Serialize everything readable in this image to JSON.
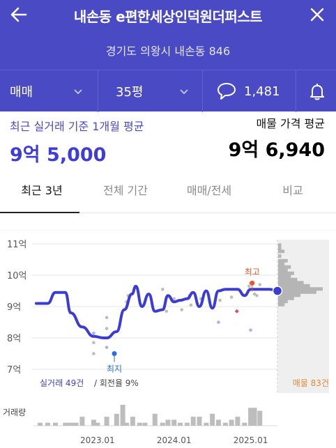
{
  "header": {
    "title": "내손동 e편한세상인덕원더퍼스트",
    "address": "경기도 의왕시 내손동 846",
    "trade_type": "매매",
    "area": "35평",
    "comment_count": "1,481",
    "back_icon": "arrow-left-icon",
    "close_icon": "close-icon",
    "comment_icon": "speech-bubble-icon",
    "bell_icon": "bell-icon"
  },
  "summary": {
    "left_caption": "최근 실거래 기준 1개월 평균",
    "left_value": "9억 5,000",
    "right_caption": "매물 가격 평균",
    "right_value": "9억 6,940"
  },
  "tabs": [
    {
      "label": "최근 3년",
      "active": true
    },
    {
      "label": "전체 기간",
      "active": false
    },
    {
      "label": "매매/전세",
      "active": false
    },
    {
      "label": "비교",
      "active": false
    }
  ],
  "colors": {
    "header_bg": "#4a4ac4",
    "line": "#3b3bd6",
    "high_marker": "#e8582c",
    "low_marker": "#2a6fe0",
    "listing_text": "#e08a3a",
    "dots": "#bdbdbd",
    "dots_blue": "#9fb6ea"
  },
  "chart_data": {
    "type": "line",
    "y_unit": "억",
    "ylim": [
      7,
      11
    ],
    "y_ticks": [
      "11억",
      "10억",
      "9억",
      "8억",
      "7억"
    ],
    "y_tick_values": [
      11,
      10,
      9,
      8,
      7
    ],
    "x_ticks": [
      "2023.01",
      "2024.01",
      "2025.01"
    ],
    "x_tick_months": [
      2023.0,
      2024.0,
      2025.0
    ],
    "x_range": [
      2022.2,
      2025.35
    ],
    "grid": true,
    "series": [
      {
        "values_x": [
          2022.2,
          2022.35,
          2022.45,
          2022.58,
          2022.65,
          2022.8,
          2022.95,
          2023.08,
          2023.12,
          2023.25,
          2023.35,
          2023.45,
          2023.5,
          2023.58,
          2023.67,
          2023.75,
          2023.85,
          2023.92,
          2024.0,
          2024.08,
          2024.17,
          2024.25,
          2024.33,
          2024.42,
          2024.5,
          2024.58,
          2024.67,
          2024.75,
          2024.83,
          2024.92,
          2025.0,
          2025.08,
          2025.17,
          2025.25,
          2025.35
        ],
        "values_y": [
          9.1,
          9.1,
          9.45,
          9.45,
          8.8,
          8.35,
          8.05,
          8.0,
          8.0,
          8.2,
          8.9,
          9.4,
          9.65,
          9.0,
          9.4,
          8.85,
          8.9,
          9.35,
          9.15,
          9.2,
          9.25,
          9.45,
          9.0,
          9.5,
          8.95,
          9.5,
          9.55,
          9.55,
          9.55,
          9.35,
          9.55,
          9.55,
          9.55,
          9.55,
          9.5
        ]
      }
    ],
    "scatter_x": [
      2022.95,
      2022.95,
      2023.12,
      2023.12,
      2023.35,
      2023.38,
      2023.4,
      2023.85,
      2023.9,
      2024.0,
      2024.1,
      2024.2,
      2024.22,
      2024.35,
      2024.6,
      2024.75,
      2024.98,
      2025.0,
      2025.05,
      2025.08,
      2025.12
    ],
    "scatter_y": [
      7.85,
      7.5,
      8.65,
      8.3,
      8.9,
      9.15,
      9.35,
      9.55,
      8.85,
      9.25,
      8.9,
      9.35,
      9.05,
      9.25,
      9.2,
      9.3,
      9.65,
      9.75,
      9.4,
      9.35,
      9.7
    ],
    "scatter_blue_x": [
      2022.95,
      2023.12,
      2024.58,
      2025.0
    ],
    "scatter_blue_y": [
      8.15,
      7.7,
      8.5,
      8.25
    ],
    "red_dot": {
      "x": 2024.82,
      "y": 8.85
    },
    "high_label": "최고",
    "high_point": {
      "x": 2025.02,
      "y": 9.75
    },
    "low_label": "최지",
    "low_point": {
      "x": 2023.22,
      "y": 7.5
    },
    "end_point": {
      "x": 2025.35,
      "y": 9.5
    },
    "trade_summary": "실거래 49건",
    "turnover": "회전율 9%",
    "listing_count": "매물 83건",
    "listing_histogram_y": [
      10.95,
      10.85,
      10.75,
      10.6,
      10.45,
      10.35,
      10.25,
      10.15,
      10.05,
      9.95,
      9.85,
      9.75,
      9.65,
      9.55,
      9.45,
      9.35,
      9.25,
      9.15,
      9.05
    ],
    "listing_histogram_count": [
      1,
      1,
      2,
      1,
      3,
      2,
      4,
      3,
      5,
      4,
      6,
      8,
      10,
      14,
      12,
      7,
      5,
      3,
      2
    ],
    "volume_label": "거래량",
    "volume_x": [
      2022.25,
      2022.35,
      2022.45,
      2022.58,
      2022.62,
      2022.66,
      2022.72,
      2022.8,
      2022.95,
      2023.0,
      2023.12,
      2023.25,
      2023.33,
      2023.38,
      2023.46,
      2023.55,
      2023.62,
      2023.75,
      2023.85,
      2023.92,
      2024.0,
      2024.08,
      2024.17,
      2024.25,
      2024.33,
      2024.42,
      2024.5,
      2024.58,
      2024.67,
      2024.75,
      2024.83,
      2024.92,
      2025.0,
      2025.05,
      2025.12
    ],
    "volume": [
      1,
      1,
      1,
      1,
      1,
      1,
      1,
      3,
      2,
      1,
      3,
      4,
      7,
      1,
      3,
      1,
      1,
      4,
      1,
      2,
      2,
      1,
      1,
      3,
      3,
      1,
      4,
      2,
      1,
      2,
      3,
      1,
      6,
      6,
      5
    ]
  }
}
